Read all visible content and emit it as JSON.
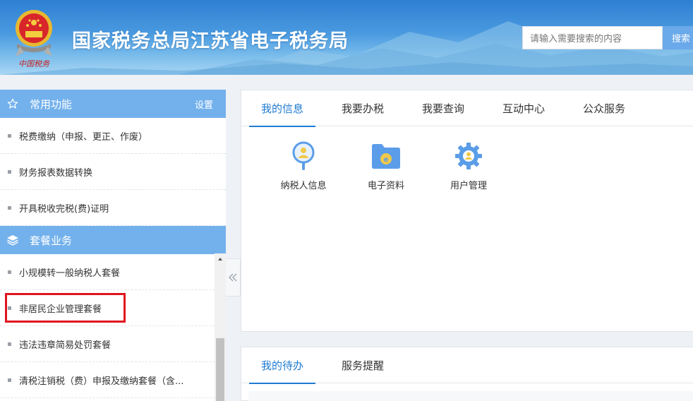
{
  "header": {
    "title": "国家税务总局江苏省电子税务局",
    "emblem_caption": "中国税务",
    "search": {
      "placeholder": "请输入需要搜索的内容",
      "button_label": "搜索"
    }
  },
  "sidebar": {
    "sections": [
      {
        "title": "常用功能",
        "icon": "star-icon",
        "action_label": "设置",
        "items": [
          {
            "label": "税费缴纳（申报、更正、作废）"
          },
          {
            "label": "财务报表数据转换"
          },
          {
            "label": "开具税收完税(费)证明"
          }
        ]
      },
      {
        "title": "套餐业务",
        "icon": "layers-icon",
        "items": [
          {
            "label": "小规模转一般纳税人套餐"
          },
          {
            "label": "非居民企业管理套餐",
            "highlighted": true
          },
          {
            "label": "违法违章简易处罚套餐"
          },
          {
            "label": "清税注销税（费）申报及缴纳套餐（含..."
          }
        ]
      }
    ]
  },
  "main": {
    "info_panel": {
      "tabs": [
        {
          "label": "我的信息",
          "active": true
        },
        {
          "label": "我要办税"
        },
        {
          "label": "我要查询"
        },
        {
          "label": "互动中心"
        },
        {
          "label": "公众服务"
        }
      ],
      "functions": [
        {
          "label": "纳税人信息",
          "icon": "taxpayer-info-icon"
        },
        {
          "label": "电子资料",
          "icon": "electronic-folder-icon"
        },
        {
          "label": "用户管理",
          "icon": "user-settings-gear-icon"
        }
      ]
    },
    "todo_panel": {
      "tabs": [
        {
          "label": "我的待办",
          "active": true
        },
        {
          "label": "服务提醒"
        }
      ]
    }
  },
  "colors": {
    "header_blue": "#2e7fd3",
    "sidebar_head": "#73b1ec",
    "active_tab": "#1f7bd1",
    "highlight_red": "#e0141e",
    "icon_blue": "#5b9de8",
    "icon_gold": "#f0c94a"
  }
}
